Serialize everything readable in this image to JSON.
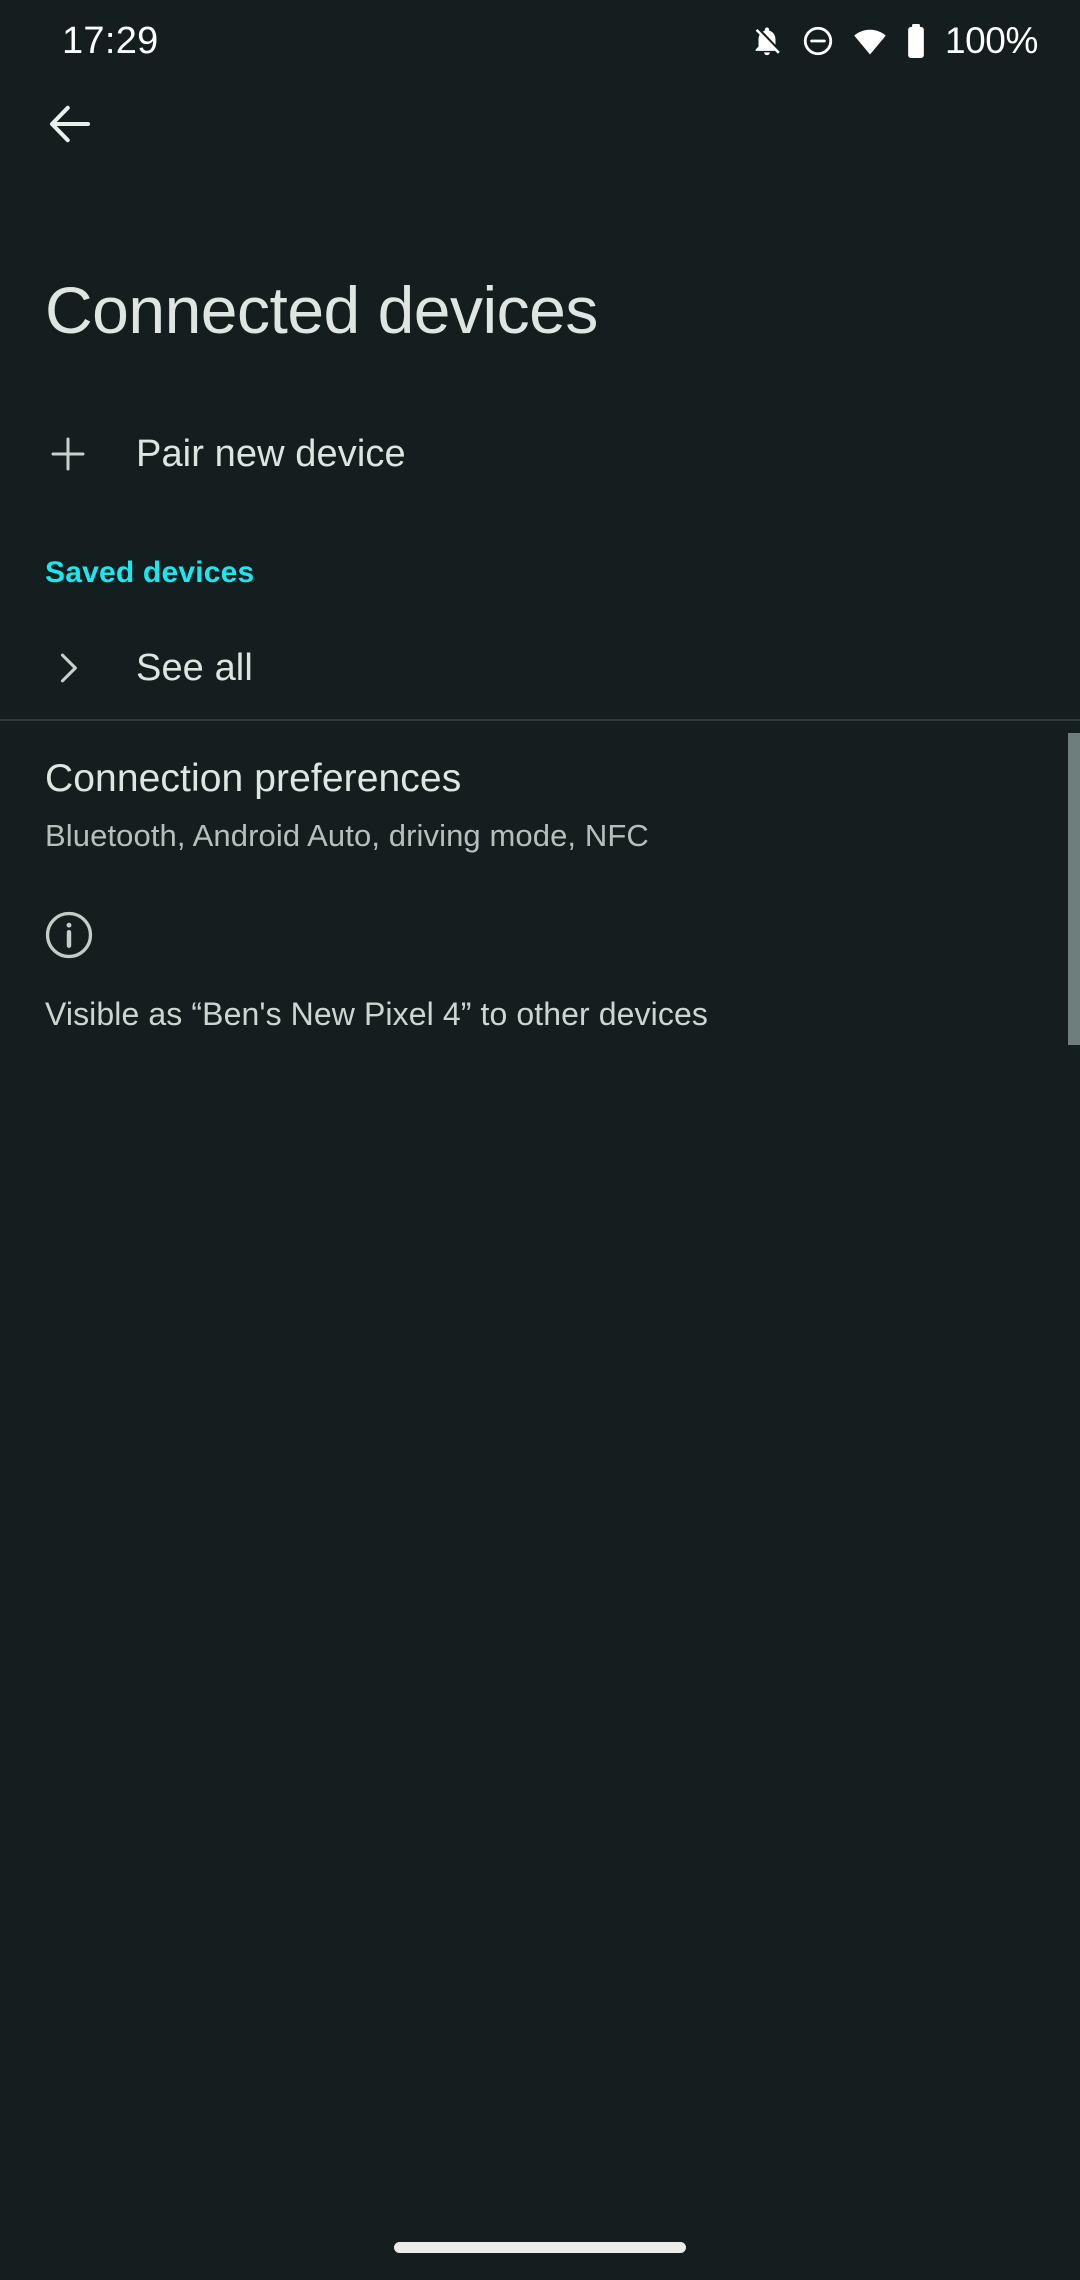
{
  "status_bar": {
    "time": "17:29",
    "battery_percent": "100%",
    "icons": [
      "notifications-off-icon",
      "do-not-disturb-icon",
      "wifi-icon",
      "battery-full-icon"
    ]
  },
  "nav": {
    "back_label": "Back",
    "back_icon": "arrow-back-icon"
  },
  "header": {
    "title": "Connected devices"
  },
  "rows": {
    "pair_new_device": {
      "label": "Pair new device",
      "icon": "plus-icon"
    },
    "see_all": {
      "label": "See all",
      "icon": "chevron-right-icon"
    }
  },
  "sections": {
    "saved_devices_label": "Saved devices"
  },
  "preferences": {
    "title": "Connection preferences",
    "subtitle": "Bluetooth, Android Auto, driving mode, NFC"
  },
  "footer": {
    "info_icon": "info-icon",
    "visibility_text": "Visible as “Ben's New Pixel 4” to other devices"
  },
  "colors": {
    "background": "#141e1e",
    "accent_cyan": "#18e8f2",
    "primary_text": "#dee6e1",
    "secondary_text": "#b6c0bb",
    "divider": "#2f3b3b",
    "scrollbar": "#6e7e7c"
  }
}
